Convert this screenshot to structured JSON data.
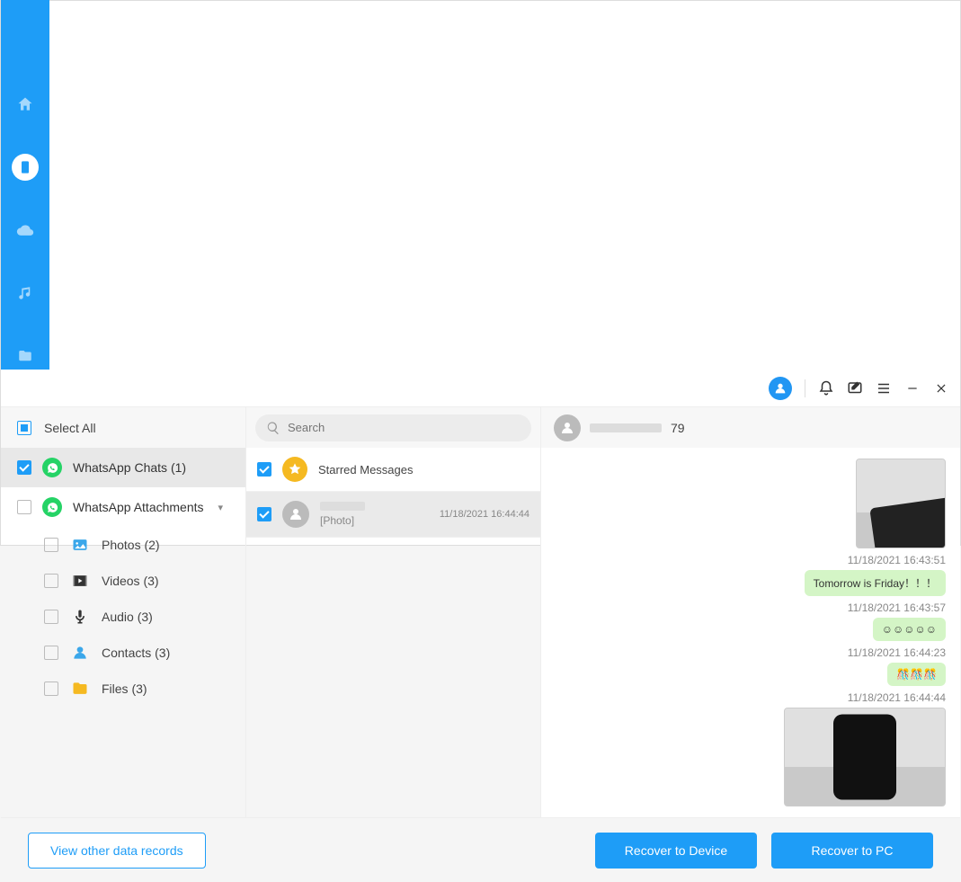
{
  "sidebar": {
    "select_all": "Select All",
    "whatsapp_chats": "WhatsApp Chats (1)",
    "whatsapp_attachments": "WhatsApp Attachments",
    "photos": "Photos (2)",
    "videos": "Videos (3)",
    "audio": "Audio (3)",
    "contacts": "Contacts (3)",
    "files": "Files (3)"
  },
  "search": {
    "placeholder": "Search"
  },
  "chatlist": {
    "starred": "Starred Messages",
    "item1_sub": "[Photo]",
    "item1_ts": "11/18/2021 16:44:44"
  },
  "chat_header": {
    "suffix": "79"
  },
  "messages": {
    "m1_ts": "11/18/2021 16:43:51",
    "m1_text": "Tomorrow is Friday！！！",
    "m2_ts": "11/18/2021 16:43:57",
    "m2_text": "☺☺☺☺☺",
    "m3_ts": "11/18/2021 16:44:23",
    "m3_text": "🎊🎊🎊",
    "m4_ts": "11/18/2021 16:44:44"
  },
  "footer": {
    "other": "View other data records",
    "to_device": "Recover to Device",
    "to_pc": "Recover to PC"
  }
}
